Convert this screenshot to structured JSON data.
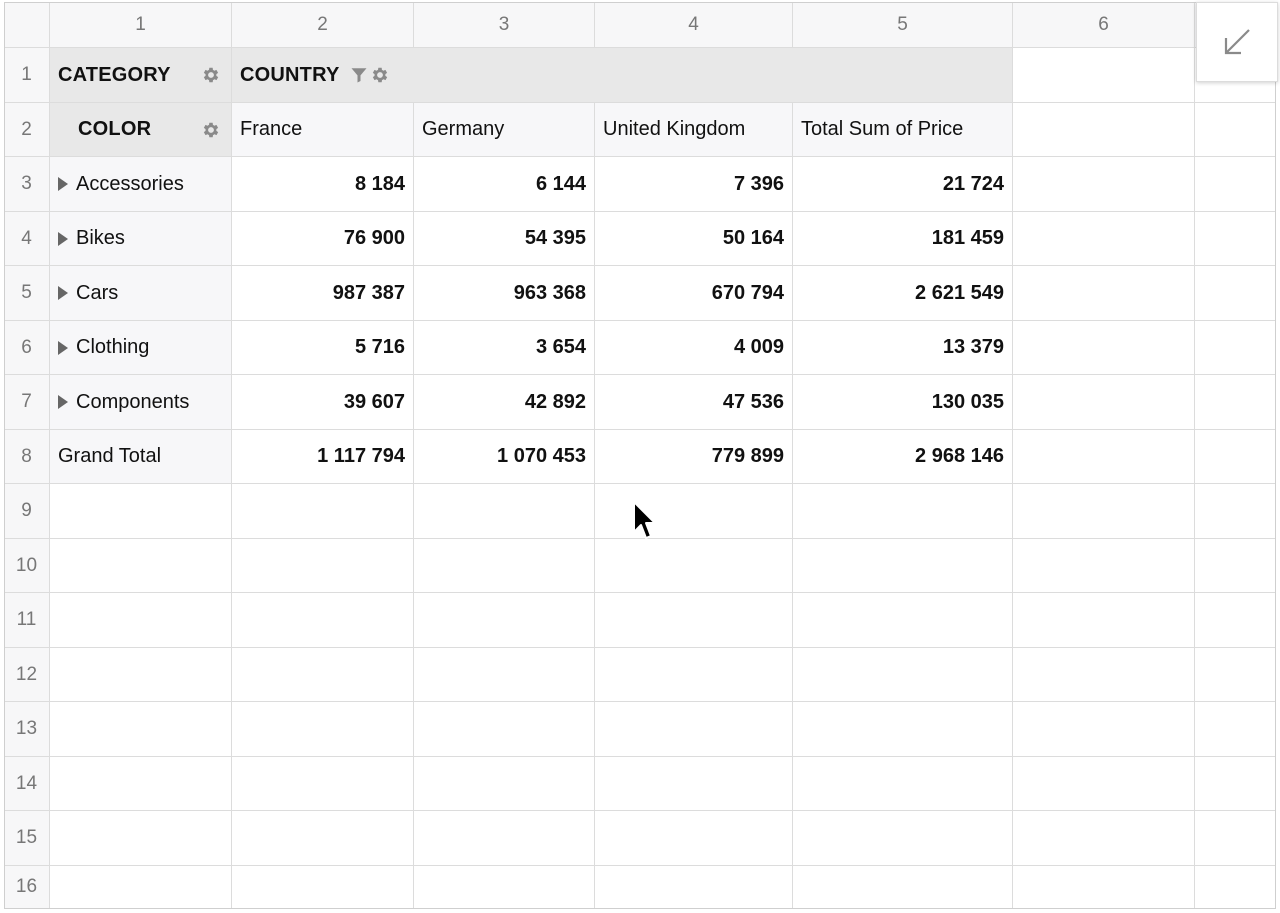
{
  "column_headers": [
    "1",
    "2",
    "3",
    "4",
    "5",
    "6"
  ],
  "row_numbers": [
    "1",
    "2",
    "3",
    "4",
    "5",
    "6",
    "7",
    "8",
    "9",
    "10",
    "11",
    "12",
    "13",
    "14",
    "15",
    "16"
  ],
  "pivot": {
    "row_field": "CATEGORY",
    "column_field": "COUNTRY",
    "sub_row_field": "COLOR",
    "columns": [
      "France",
      "Germany",
      "United Kingdom",
      "Total Sum of Price"
    ],
    "rows": [
      {
        "label": "Accessories",
        "values": [
          "8 184",
          "6 144",
          "7 396",
          "21 724"
        ]
      },
      {
        "label": "Bikes",
        "values": [
          "76 900",
          "54 395",
          "50 164",
          "181 459"
        ]
      },
      {
        "label": "Cars",
        "values": [
          "987 387",
          "963 368",
          "670 794",
          "2 621 549"
        ]
      },
      {
        "label": "Clothing",
        "values": [
          "5 716",
          "3 654",
          "4 009",
          "13 379"
        ]
      },
      {
        "label": "Components",
        "values": [
          "39 607",
          "42 892",
          "47 536",
          "130 035"
        ]
      }
    ],
    "grand_total": {
      "label": "Grand Total",
      "values": [
        "1 117 794",
        "1 070 453",
        "779 899",
        "2 968 146"
      ]
    }
  },
  "icons": {
    "settings": "gear-icon",
    "filter": "filter-icon",
    "expand": "expand-arrow-icon",
    "collapse_panel": "collapse-arrow-icon",
    "pointer": "mouse-cursor-icon"
  },
  "colors": {
    "header_bg": "#f7f7f8",
    "pivot_header_bg": "#e8e8e8",
    "grid_line": "#dcdcdc"
  }
}
